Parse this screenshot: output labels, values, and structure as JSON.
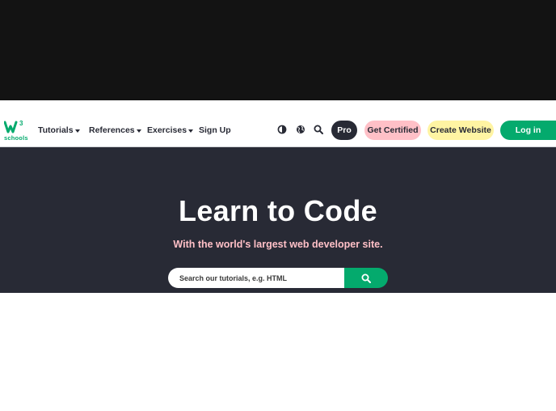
{
  "logo": {
    "mark_text": "w",
    "superscript": "3",
    "subtext": "schools"
  },
  "nav": {
    "tutorials": "Tutorials",
    "references": "References",
    "exercises": "Exercises",
    "signup": "Sign Up"
  },
  "icons": {
    "theme": "contrast-icon",
    "language": "globe-icon",
    "search": "search-icon",
    "search_submit": "search-icon"
  },
  "buttons": {
    "pro": "Pro",
    "certified": "Get Certified",
    "create_website": "Create Website",
    "login": "Log in"
  },
  "hero": {
    "title": "Learn to Code",
    "subtitle": "With the world's largest web developer site.",
    "search_placeholder": "Search our tutorials, e.g. HTML"
  },
  "colors": {
    "brand_green": "#04aa6d",
    "hero_bg": "#282a35",
    "pink": "#ffc0c7",
    "yellow": "#fff4a3"
  }
}
